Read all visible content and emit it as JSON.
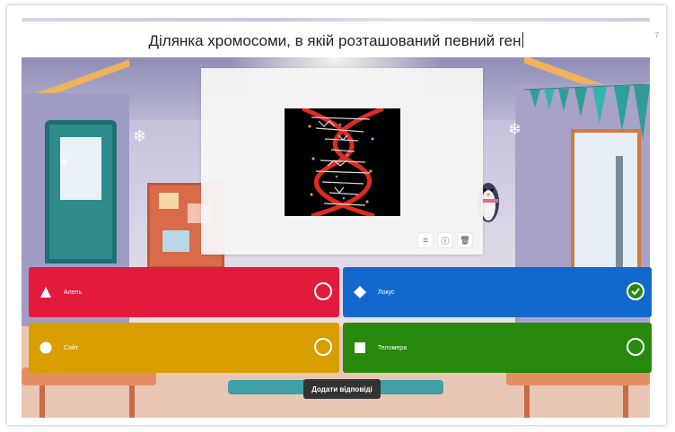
{
  "question": {
    "text": "Ділянка хромосоми, в якій розташований певний ген"
  },
  "counter": "7",
  "media_tools": [
    {
      "name": "crop-icon",
      "glyph": "⌗"
    },
    {
      "name": "info-icon",
      "glyph": "ⓘ"
    },
    {
      "name": "trash-icon",
      "glyph": "🗑"
    }
  ],
  "answers": [
    {
      "label": "Алель",
      "shape": "triangle",
      "color": "#e21b3c",
      "correct": false
    },
    {
      "label": "Локус",
      "shape": "diamond",
      "color": "#1368ce",
      "correct": true
    },
    {
      "label": "Сайт",
      "shape": "circle",
      "color": "#d89e00",
      "correct": false
    },
    {
      "label": "Теломера",
      "shape": "square",
      "color": "#26890c",
      "correct": false
    }
  ],
  "add_answers_label": "Додати відповіді"
}
